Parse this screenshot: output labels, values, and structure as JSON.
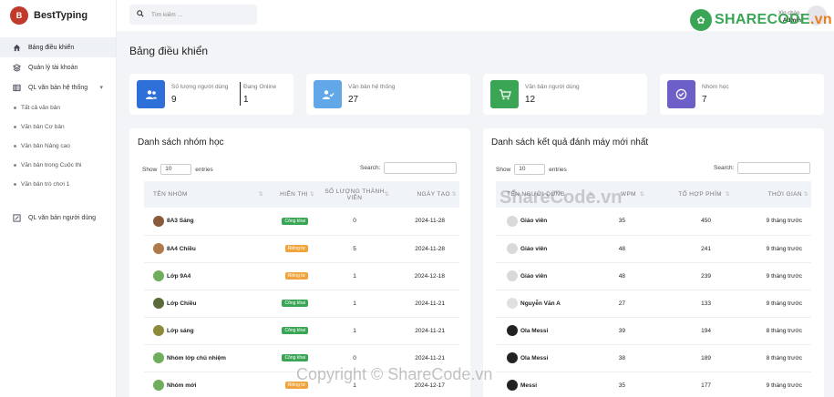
{
  "app": {
    "name": "BestTyping",
    "logo_initial": "B"
  },
  "search": {
    "placeholder": "Tìm kiếm ..."
  },
  "user": {
    "greeting": "Xin chào,",
    "name": "Admin"
  },
  "sidebar": {
    "items": [
      {
        "label": "Bảng điều khiển",
        "icon": "home-icon"
      },
      {
        "label": "Quản lý tài khoản",
        "icon": "layers-icon"
      },
      {
        "label": "QL văn bản hệ thống",
        "icon": "table-icon"
      }
    ],
    "sub_items": [
      "Tất cả văn bản",
      "Văn bản Cơ bản",
      "Văn bản Nâng cao",
      "Văn bản trong Cuộc thi",
      "Văn bản trò chơi 1"
    ],
    "bottom_item": {
      "label": "QL văn bản người dùng",
      "icon": "edit-icon"
    }
  },
  "page": {
    "title": "Bảng điều khiển"
  },
  "stats": [
    {
      "label": "Số lượng người dùng",
      "value": "9",
      "label2": "Đang Online",
      "value2": "1",
      "color": "#2f6fd8",
      "icon": "users-icon"
    },
    {
      "label": "Văn bản hệ thống",
      "value": "27",
      "color": "#62a7e8",
      "icon": "user-check-icon"
    },
    {
      "label": "Văn bản người dùng",
      "value": "12",
      "color": "#3aa655",
      "icon": "cart-icon"
    },
    {
      "label": "Nhóm học",
      "value": "7",
      "color": "#6c5fc7",
      "icon": "check-circle-icon"
    }
  ],
  "groups": {
    "title": "Danh sách nhóm học",
    "show_label": "Show",
    "entries_value": "10",
    "entries_label": "entries",
    "search_label": "Search:",
    "columns": [
      "TÊN NHÓM",
      "HIỂN THỊ",
      "SỐ LƯỢNG THÀNH VIÊN",
      "NGÀY TẠO"
    ],
    "rows": [
      {
        "name": "8A3 Sáng",
        "visibility": "Công khai",
        "vis_color": "green",
        "members": "0",
        "date": "2024-11-28"
      },
      {
        "name": "8A4 Chiều",
        "visibility": "Riêng tư",
        "vis_color": "orange",
        "members": "5",
        "date": "2024-11-28"
      },
      {
        "name": "Lớp 9A4",
        "visibility": "Riêng tư",
        "vis_color": "orange",
        "members": "1",
        "date": "2024-12-18"
      },
      {
        "name": "Lớp Chiều",
        "visibility": "Công khai",
        "vis_color": "green",
        "members": "1",
        "date": "2024-11-21"
      },
      {
        "name": "Lớp sáng",
        "visibility": "Công khai",
        "vis_color": "green",
        "members": "1",
        "date": "2024-11-21"
      },
      {
        "name": "Nhóm lớp chủ nhiệm",
        "visibility": "Công khai",
        "vis_color": "green",
        "members": "0",
        "date": "2024-11-21"
      },
      {
        "name": "Nhóm mới",
        "visibility": "Riêng tư",
        "vis_color": "orange",
        "members": "1",
        "date": "2024-12-17"
      }
    ]
  },
  "results": {
    "title": "Danh sách kết quả đánh máy mới nhất",
    "show_label": "Show",
    "entries_value": "10",
    "entries_label": "entries",
    "search_label": "Search:",
    "columns": [
      "TÊN NGƯỜI DÙNG",
      "WPM",
      "TỔ HỢP PHÍM",
      "THỜI GIAN"
    ],
    "rows": [
      {
        "name": "Giáo viên",
        "wpm": "35",
        "keys": "450",
        "time": "9 tháng trước"
      },
      {
        "name": "Giáo viên",
        "wpm": "48",
        "keys": "241",
        "time": "9 tháng trước"
      },
      {
        "name": "Giáo viên",
        "wpm": "48",
        "keys": "239",
        "time": "9 tháng trước"
      },
      {
        "name": "Nguyễn Văn A",
        "wpm": "27",
        "keys": "133",
        "time": "9 tháng trước"
      },
      {
        "name": "Ola Messi",
        "wpm": "39",
        "keys": "194",
        "time": "8 tháng trước"
      },
      {
        "name": "Ola Messi",
        "wpm": "38",
        "keys": "189",
        "time": "8 tháng trước"
      },
      {
        "name": "Messi",
        "wpm": "35",
        "keys": "177",
        "time": "9 tháng trước"
      }
    ]
  },
  "watermark": {
    "logo_main": "SHARECODE",
    "logo_tld": ".vn",
    "center": "ShareCode.vn",
    "bottom": "Copyright © ShareCode.vn"
  }
}
